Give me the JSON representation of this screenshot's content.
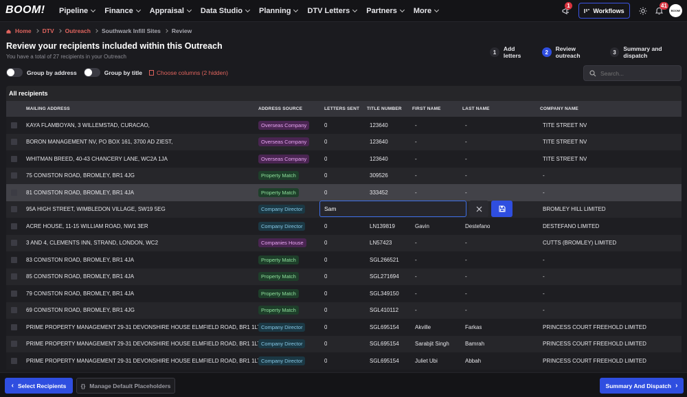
{
  "nav": {
    "logo": "BOOM!",
    "menu": [
      "Pipeline",
      "Finance",
      "Appraisal",
      "Data Studio",
      "Planning",
      "DTV Letters",
      "Partners",
      "More"
    ],
    "notifications_badge": "1",
    "workflows_label": "Workflows",
    "bell_badge": "41",
    "avatar_text": "BOOM!"
  },
  "breadcrumb": {
    "home": "Home",
    "dtv": "DTV",
    "outreach": "Outreach",
    "site": "Southwark Infill Sites",
    "current": "Review"
  },
  "header": {
    "title": "Review your recipients included within this Outreach",
    "subtitle": "You have a total of 27 recipients in your Outreach"
  },
  "steps": [
    {
      "num": "1",
      "label": "Add letters"
    },
    {
      "num": "2",
      "label": "Review outreach"
    },
    {
      "num": "3",
      "label": "Summary and dispatch"
    }
  ],
  "controls": {
    "group_by_address": "Group by address",
    "group_by_title": "Group by title",
    "choose_columns": "Choose columns (2 hidden)",
    "search_placeholder": "Search..."
  },
  "table": {
    "title": "All recipients",
    "columns": [
      "MAILING ADDRESS",
      "ADDRESS SOURCE",
      "LETTERS SENT",
      "TITLE NUMBER",
      "FIRST NAME",
      "LAST NAME",
      "COMPANY NAME"
    ],
    "rows": [
      {
        "address": "KAYA FLAMBOYAN, 3 WILLEMSTAD, CURACAO,",
        "source": "Overseas Company",
        "sent": "0",
        "title": "123640",
        "first": "-",
        "last": "-",
        "company": "TITE STREET NV"
      },
      {
        "address": "BORON MANAGEMENT NV, PO BOX 161, 3700 AD ZIEST,",
        "source": "Overseas Company",
        "sent": "0",
        "title": "123640",
        "first": "-",
        "last": "-",
        "company": "TITE STREET NV"
      },
      {
        "address": "WHITMAN BREED, 40-43 CHANCERY LANE, WC2A 1JA",
        "source": "Overseas Company",
        "sent": "0",
        "title": "123640",
        "first": "-",
        "last": "-",
        "company": "TITE STREET NV"
      },
      {
        "address": "75 CONISTON ROAD, BROMLEY, BR1 4JG",
        "source": "Property Match",
        "sent": "0",
        "title": "309526",
        "first": "-",
        "last": "-",
        "company": "-"
      },
      {
        "address": "81 CONISTON ROAD, BROMLEY, BR1 4JA",
        "source": "Property Match",
        "sent": "0",
        "title": "333452",
        "first": "-",
        "last": "-",
        "company": "-"
      },
      {
        "address": "95A HIGH STREET, WIMBLEDON VILLAGE, SW19 5EG",
        "source": "Company Director",
        "sent": "",
        "title": "",
        "first": "",
        "last": "",
        "company": "BROMLEY HILL LIMITED"
      },
      {
        "address": "ACRE HOUSE, 11-15 WILLIAM ROAD, NW1 3ER",
        "source": "Company Director",
        "sent": "0",
        "title": "LN139819",
        "first": "Gavin",
        "last": "Destefano",
        "company": "DESTEFANO LIMITED"
      },
      {
        "address": "3 AND 4, CLEMENTS INN, STRAND, LONDON, WC2",
        "source": "Companies House",
        "sent": "0",
        "title": "LN57423",
        "first": "-",
        "last": "-",
        "company": "CUTTS (BROMLEY) LIMITED"
      },
      {
        "address": "83 CONISTON ROAD, BROMLEY, BR1 4JA",
        "source": "Property Match",
        "sent": "0",
        "title": "SGL266521",
        "first": "-",
        "last": "-",
        "company": "-"
      },
      {
        "address": "85 CONISTON ROAD, BROMLEY, BR1 4JA",
        "source": "Property Match",
        "sent": "0",
        "title": "SGL271694",
        "first": "-",
        "last": "-",
        "company": "-"
      },
      {
        "address": "79 CONISTON ROAD, BROMLEY, BR1 4JA",
        "source": "Property Match",
        "sent": "0",
        "title": "SGL349150",
        "first": "-",
        "last": "-",
        "company": "-"
      },
      {
        "address": "69 CONISTON ROAD, BROMLEY, BR1 4JG",
        "source": "Property Match",
        "sent": "0",
        "title": "SGL410112",
        "first": "-",
        "last": "-",
        "company": "-"
      },
      {
        "address": "PRIME PROPERTY MANAGEMENT 29-31 DEVONSHIRE HOUSE ELMFIELD ROAD, BR1 1LT",
        "source": "Company Director",
        "sent": "0",
        "title": "SGL695154",
        "first": "Akville",
        "last": "Farkas",
        "company": "PRINCESS COURT FREEHOLD LIMITED"
      },
      {
        "address": "PRIME PROPERTY MANAGEMENT 29-31 DEVONSHIRE HOUSE ELMFIELD ROAD, BR1 1LT",
        "source": "Company Director",
        "sent": "0",
        "title": "SGL695154",
        "first": "Sarabjit Singh",
        "last": "Bamrah",
        "company": "PRINCESS COURT FREEHOLD LIMITED"
      },
      {
        "address": "PRIME PROPERTY MANAGEMENT 29-31 DEVONSHIRE HOUSE ELMFIELD ROAD, BR1 1LT",
        "source": "Company Director",
        "sent": "0",
        "title": "SGL695154",
        "first": "Juliet Ubi",
        "last": "Abbah",
        "company": "PRINCESS COURT FREEHOLD LIMITED"
      }
    ]
  },
  "inline_edit": {
    "value": "Sam"
  },
  "footer": {
    "select_recipients": "Select Recipients",
    "manage_placeholders": "Manage Default Placeholders",
    "summary_dispatch": "Summary And Dispatch"
  },
  "colors": {
    "accent": "#2f4ee0",
    "link_red": "#e0645e",
    "badge_red": "#d9333f"
  }
}
